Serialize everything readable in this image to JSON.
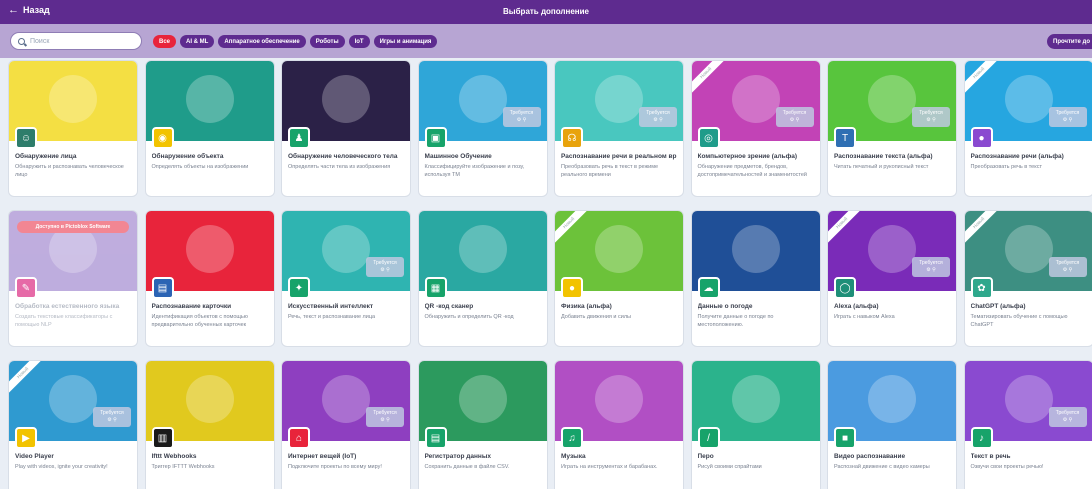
{
  "header": {
    "back_label": "Назад",
    "title": "Выбрать дополнение"
  },
  "search": {
    "placeholder": "Поиск"
  },
  "filters": [
    {
      "label": "Все",
      "active": true
    },
    {
      "label": "AI & ML",
      "active": false
    },
    {
      "label": "Аппаратное обеспечение",
      "active": false
    },
    {
      "label": "Роботы",
      "active": false
    },
    {
      "label": "IoT",
      "active": false
    },
    {
      "label": "Игры и анимация",
      "active": false
    }
  ],
  "read_button": "Прочтите до",
  "requires_label": "Требуется",
  "new_ribbon": "Новый",
  "ribbon_banner": "Доступно в Pictoblox Software",
  "extensions": [
    {
      "title": "Обнаружение лица",
      "desc": "Обнаружить и распознавать человеческое лицо",
      "art_color": "#f4df43",
      "icon_color": "#2e7d6b",
      "icon": "face-icon",
      "new": false,
      "requires": false
    },
    {
      "title": "Обнаружение объекта",
      "desc": "Определять объекты на изображении",
      "art_color": "#1f9c8a",
      "icon_color": "#f2c300",
      "icon": "cat-icon",
      "new": false,
      "requires": false
    },
    {
      "title": "Обнаружение человеческого тела",
      "desc": "Определять части тела из изображения",
      "art_color": "#2b2147",
      "icon_color": "#17a36a",
      "icon": "body-icon",
      "new": false,
      "requires": false
    },
    {
      "title": "Машинное Обучение",
      "desc": "Классифицируйте изображение и позу, используя TM",
      "art_color": "#2fa6d8",
      "icon_color": "#17a36a",
      "icon": "ml-icon",
      "new": false,
      "requires": true
    },
    {
      "title": "Распознавание речи в реальном вр",
      "desc": "Преобразовать речь в текст в режиме реального времени",
      "art_color": "#49c7bf",
      "icon_color": "#e8a30c",
      "icon": "speech-icon",
      "new": false,
      "requires": true
    },
    {
      "title": "Компьютерное зрение (альфа)",
      "desc": "Обнаружение предметов, брендов, достопримечательностей и знаменитостей",
      "art_color": "#c243b6",
      "icon_color": "#1f9c8a",
      "icon": "eye-icon",
      "new": true,
      "requires": true
    },
    {
      "title": "Распознавание текста (альфа)",
      "desc": "Читать печатный и рукописный текст",
      "art_color": "#58c53d",
      "icon_color": "#2f6fb3",
      "icon": "text-icon",
      "new": false,
      "requires": true
    },
    {
      "title": "Распознавание речи (альфа)",
      "desc": "Преобразовать речь в текст",
      "art_color": "#26a6e0",
      "icon_color": "#8a4ad0",
      "icon": "voice-icon",
      "new": true,
      "requires": true
    },
    {
      "title": "Обработка естественного языка",
      "desc": "Создать текстовые классификаторы с помощью NLP",
      "art_color": "#8a6bc4",
      "icon_color": "#e66aa7",
      "icon": "nlp-icon",
      "new": false,
      "requires": false,
      "disabled": true,
      "banner": true
    },
    {
      "title": "Распознавание карточки",
      "desc": "Идентификация объектов с помощью предварительно обученных карточек",
      "art_color": "#e8243b",
      "icon_color": "#2c64b4",
      "icon": "card-icon",
      "new": false,
      "requires": false
    },
    {
      "title": "Искусственный интеллект",
      "desc": "Речь, текст и распознавание лица",
      "art_color": "#2fb4b1",
      "icon_color": "#17a36a",
      "icon": "ai-icon",
      "new": false,
      "requires": true
    },
    {
      "title": "QR -код сканер",
      "desc": "Обнаружить и определить QR -код",
      "art_color": "#2aa8a2",
      "icon_color": "#17a36a",
      "icon": "qr-icon",
      "new": false,
      "requires": false
    },
    {
      "title": "Физика (альфа)",
      "desc": "Добавить движения и силы",
      "art_color": "#6cc23a",
      "icon_color": "#f2c300",
      "icon": "physics-icon",
      "new": true,
      "requires": false
    },
    {
      "title": "Данные о погоде",
      "desc": "Получите данные о погоде по местоположению.",
      "art_color": "#1f4f97",
      "icon_color": "#17a36a",
      "icon": "weather-icon",
      "new": false,
      "requires": false
    },
    {
      "title": "Alexa (альфа)",
      "desc": "Играть с навыком Alexa",
      "art_color": "#7a2bb8",
      "icon_color": "#1f8f78",
      "icon": "alexa-icon",
      "new": true,
      "requires": true
    },
    {
      "title": "ChatGPT (альфа)",
      "desc": "Тематизировать обучение с помощью ChatGPT",
      "art_color": "#3d8f82",
      "icon_color": "#2ea88c",
      "icon": "chatgpt-icon",
      "new": true,
      "requires": true
    },
    {
      "title": "Video Player",
      "desc": "Play with videos, ignite your creativity!",
      "art_color": "#2f9ad0",
      "icon_color": "#f2c300",
      "icon": "video-icon",
      "new": true,
      "requires": true
    },
    {
      "title": "Ifttt Webhooks",
      "desc": "Триггер IFTTT Webhooks",
      "art_color": "#e1c91e",
      "icon_color": "#1a1a1a",
      "icon": "ifttt-icon",
      "new": false,
      "requires": false
    },
    {
      "title": "Интернет вещей (IoT)",
      "desc": "Подключите проекты по всему миру!",
      "art_color": "#8e3fc0",
      "icon_color": "#e8243b",
      "icon": "iot-icon",
      "new": false,
      "requires": true
    },
    {
      "title": "Регистратор данных",
      "desc": "Сохранить данные в файле CSV.",
      "art_color": "#2c9a5e",
      "icon_color": "#17a36a",
      "icon": "sheet-icon",
      "new": false,
      "requires": false
    },
    {
      "title": "Музыка",
      "desc": "Играть на инструментах и барабанах.",
      "art_color": "#b14fc4",
      "icon_color": "#17a36a",
      "icon": "music-icon",
      "new": false,
      "requires": false
    },
    {
      "title": "Перо",
      "desc": "Рисуй своими спрайтами",
      "art_color": "#2bb38c",
      "icon_color": "#17a36a",
      "icon": "pen-icon",
      "new": false,
      "requires": false
    },
    {
      "title": "Видео распознавание",
      "desc": "Распознай движение с видео камеры",
      "art_color": "#4b9be0",
      "icon_color": "#17a36a",
      "icon": "video-sensing-icon",
      "new": false,
      "requires": false
    },
    {
      "title": "Текст в речь",
      "desc": "Озвучи свои проекты речью!",
      "art_color": "#8a4ad0",
      "icon_color": "#17a36a",
      "icon": "tts-icon",
      "new": false,
      "requires": true
    }
  ]
}
